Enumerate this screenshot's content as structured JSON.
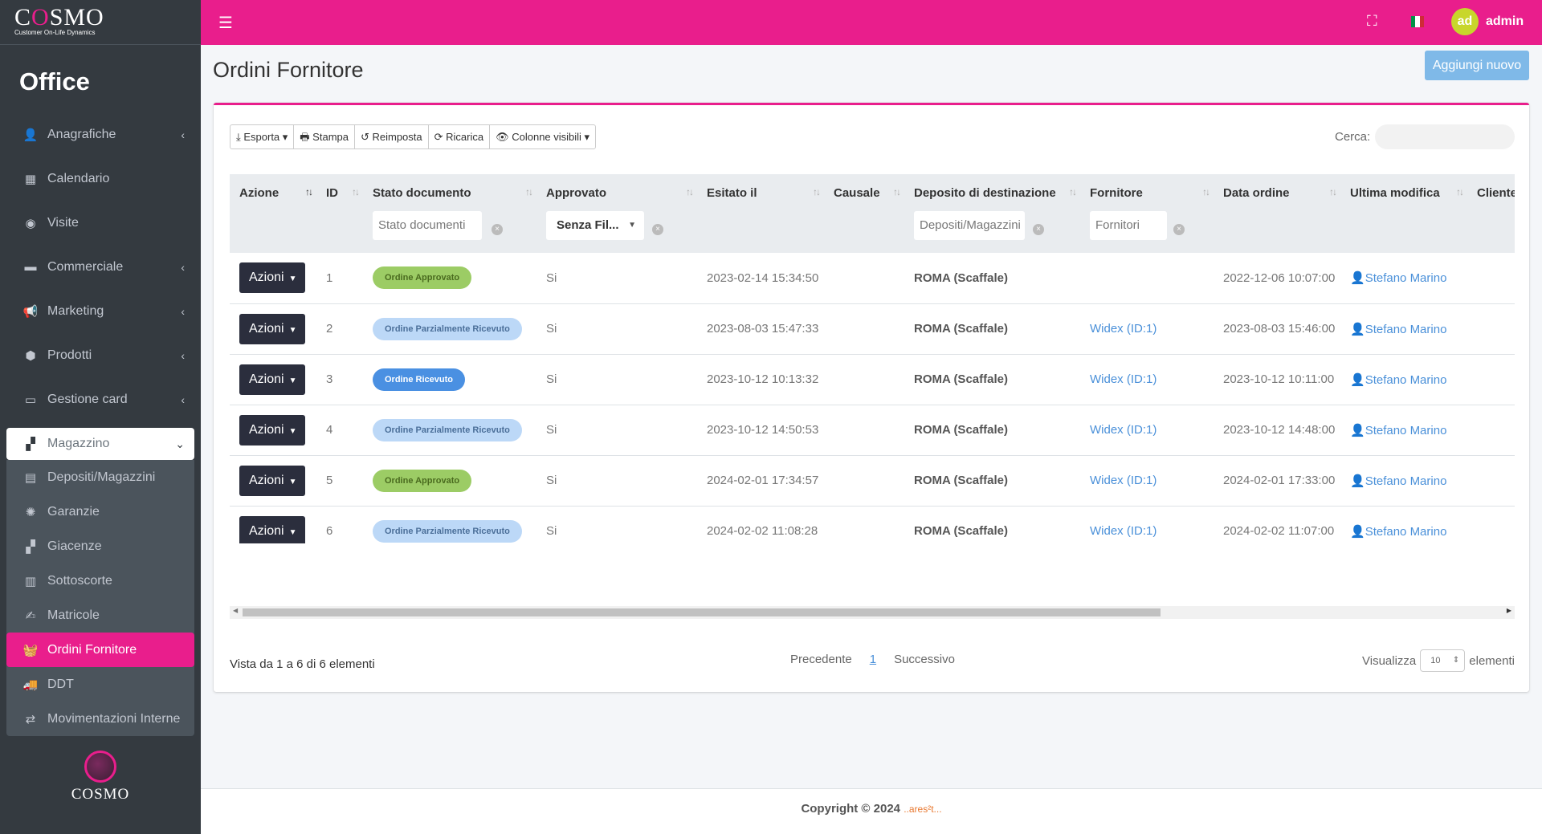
{
  "brand": {
    "logo": "COSMO",
    "logo_o": "O",
    "tagline": "Customer On-Life Dynamics",
    "section": "Office"
  },
  "nav": {
    "items": [
      {
        "label": "Anagrafiche",
        "icon": "user-plus-icon",
        "glyph": "👤",
        "chevron": "‹"
      },
      {
        "label": "Calendario",
        "icon": "calendar-icon",
        "glyph": "▦",
        "chevron": ""
      },
      {
        "label": "Visite",
        "icon": "eye-icon",
        "glyph": "◉",
        "chevron": ""
      },
      {
        "label": "Commerciale",
        "icon": "wallet-icon",
        "glyph": "▬",
        "chevron": "‹"
      },
      {
        "label": "Marketing",
        "icon": "bullhorn-icon",
        "glyph": "📢",
        "chevron": "‹"
      },
      {
        "label": "Prodotti",
        "icon": "box-icon",
        "glyph": "⬢",
        "chevron": "‹"
      },
      {
        "label": "Gestione card",
        "icon": "credit-card-icon",
        "glyph": "▭",
        "chevron": "‹"
      }
    ],
    "open": {
      "label": "Magazzino",
      "icon": "cubes-icon",
      "glyph": "▞",
      "chevron": "⌄"
    },
    "subitems": [
      {
        "label": "Depositi/Magazzini",
        "icon": "warehouse-icon",
        "glyph": "▤"
      },
      {
        "label": "Garanzie",
        "icon": "badge-icon",
        "glyph": "✺"
      },
      {
        "label": "Giacenze",
        "icon": "cubes-icon",
        "glyph": "▞"
      },
      {
        "label": "Sottoscorte",
        "icon": "archive-icon",
        "glyph": "▥"
      },
      {
        "label": "Matricole",
        "icon": "signature-icon",
        "glyph": "✍"
      },
      {
        "label": "Ordini Fornitore",
        "icon": "basket-icon",
        "glyph": "🧺",
        "active": true
      },
      {
        "label": "DDT",
        "icon": "truck-icon",
        "glyph": "🚚"
      },
      {
        "label": "Movimentazioni Interne",
        "icon": "exchange-icon",
        "glyph": "⇄"
      }
    ],
    "footer_logo": "COSMO"
  },
  "topbar": {
    "user_initials": "ad",
    "user_name": "admin",
    "menu_glyph": "☰",
    "expand_glyph": "⛶",
    "flag_colors": [
      "#009246",
      "#ffffff",
      "#ce2b37"
    ]
  },
  "page": {
    "title": "Ordini Fornitore",
    "add_button": "Aggiungi nuovo"
  },
  "toolbar": {
    "export": "⤓ Esporta ▾",
    "print": "🖶 Stampa",
    "reset": "↺ Reimposta",
    "reload": "⟳ Ricarica",
    "columns": "👁 Colonne visibili ▾",
    "search_label": "Cerca:"
  },
  "table": {
    "columns": [
      "Azione",
      "ID",
      "Stato documento",
      "Approvato",
      "Esitato il",
      "Causale",
      "Deposito di destinazione",
      "Fornitore",
      "Data ordine",
      "Ultima modifica",
      "Cliente fin"
    ],
    "filters": {
      "stato": "Stato documenti",
      "approvato": "Senza Fil...",
      "deposito": "Depositi/Magazzini",
      "fornitore": "Fornitori"
    },
    "action_label": "Azioni",
    "rows": [
      {
        "id": "1",
        "stato": "Ordine Approvato",
        "stato_bg": "#9ccc65",
        "stato_fg": "#4a6b1f",
        "approvato": "Si",
        "esitato": "2023-02-14 15:34:50",
        "deposito": "ROMA (Scaffale)",
        "fornitore": "",
        "data": "2022-12-06 10:07:00",
        "modifica": "Stefano Marino"
      },
      {
        "id": "2",
        "stato": "Ordine Parzialmente Ricevuto",
        "stato_bg": "#bcd8f7",
        "stato_fg": "#4b6f99",
        "approvato": "Si",
        "esitato": "2023-08-03 15:47:33",
        "deposito": "ROMA (Scaffale)",
        "fornitore": "Widex (ID:1)",
        "data": "2023-08-03 15:46:00",
        "modifica": "Stefano Marino"
      },
      {
        "id": "3",
        "stato": "Ordine Ricevuto",
        "stato_bg": "#4a90e2",
        "stato_fg": "#ffffff",
        "approvato": "Si",
        "esitato": "2023-10-12 10:13:32",
        "deposito": "ROMA (Scaffale)",
        "fornitore": "Widex (ID:1)",
        "data": "2023-10-12 10:11:00",
        "modifica": "Stefano Marino"
      },
      {
        "id": "4",
        "stato": "Ordine Parzialmente Ricevuto",
        "stato_bg": "#bcd8f7",
        "stato_fg": "#4b6f99",
        "approvato": "Si",
        "esitato": "2023-10-12 14:50:53",
        "deposito": "ROMA (Scaffale)",
        "fornitore": "Widex (ID:1)",
        "data": "2023-10-12 14:48:00",
        "modifica": "Stefano Marino"
      },
      {
        "id": "5",
        "stato": "Ordine Approvato",
        "stato_bg": "#9ccc65",
        "stato_fg": "#4a6b1f",
        "approvato": "Si",
        "esitato": "2024-02-01 17:34:57",
        "deposito": "ROMA (Scaffale)",
        "fornitore": "Widex (ID:1)",
        "data": "2024-02-01 17:33:00",
        "modifica": "Stefano Marino"
      },
      {
        "id": "6",
        "stato": "Ordine Parzialmente Ricevuto",
        "stato_bg": "#bcd8f7",
        "stato_fg": "#4b6f99",
        "approvato": "Si",
        "esitato": "2024-02-02 11:08:28",
        "deposito": "ROMA (Scaffale)",
        "fornitore": "Widex (ID:1)",
        "data": "2024-02-02 11:07:00",
        "modifica": "Stefano Marino"
      }
    ]
  },
  "pagination": {
    "info": "Vista da 1 a 6 di 6 elementi",
    "prev": "Precedente",
    "current": "1",
    "next": "Successivo",
    "show_label": "Visualizza",
    "page_size": "10",
    "items_label": "elementi"
  },
  "footer": {
    "copyright": "Copyright © 2024",
    "company": "..ares²t..."
  }
}
